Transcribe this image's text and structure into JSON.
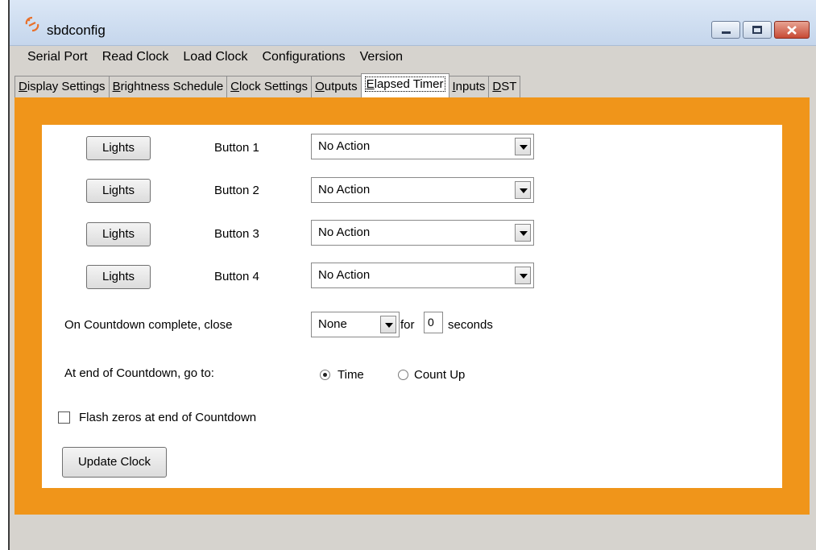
{
  "window": {
    "title": "sbdconfig",
    "icon": "app-logo-icon"
  },
  "menu": [
    "Serial Port",
    "Read Clock",
    "Load Clock",
    "Configurations",
    "Version"
  ],
  "tabs": [
    {
      "key": "D",
      "rest": "isplay Settings"
    },
    {
      "key": "B",
      "rest": "rightness Schedule"
    },
    {
      "key": "C",
      "rest": "lock Settings"
    },
    {
      "key": "O",
      "rest": "utputs"
    },
    {
      "key": "E",
      "rest": "lapsed Timer"
    },
    {
      "key": "I",
      "rest": "nputs"
    },
    {
      "key": "D",
      "rest": "ST"
    }
  ],
  "active_tab": "Elapsed Timer",
  "buttons": [
    {
      "lights_label": "Lights",
      "label": "Button 1",
      "action": "No Action"
    },
    {
      "lights_label": "Lights",
      "label": "Button 2",
      "action": "No Action"
    },
    {
      "lights_label": "Lights",
      "label": "Button 3",
      "action": "No Action"
    },
    {
      "lights_label": "Lights",
      "label": "Button 4",
      "action": "No Action"
    }
  ],
  "countdown_close": {
    "label": "On Countdown complete, close",
    "value": "None",
    "for_label": "for",
    "seconds_value": "0",
    "seconds_label": "seconds"
  },
  "countdown_goto": {
    "label": "At end of Countdown, go to:",
    "options": [
      "Time",
      "Count Up"
    ],
    "selected": "Time"
  },
  "flash_zeros": {
    "label": "Flash zeros at end of Countdown",
    "checked": false
  },
  "update_button": "Update Clock",
  "colors": {
    "panel_orange": "#f0951a",
    "panel_white": "#ffffff"
  }
}
